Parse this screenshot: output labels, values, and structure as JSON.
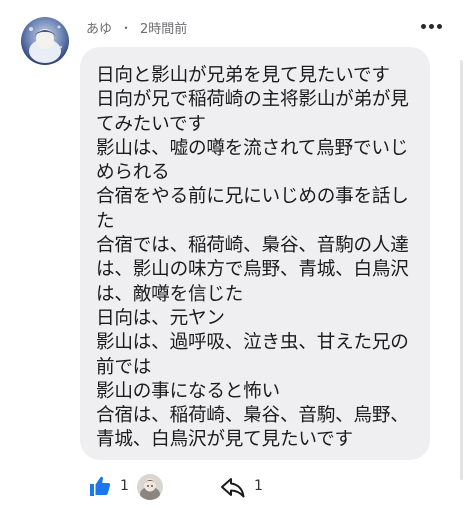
{
  "comment": {
    "author": "あゆ",
    "separator": "・",
    "time": "2時間前",
    "lines": [
      "日向と影山が兄弟を見て見たいです",
      "日向が兄で稲荷崎の主将影山が弟が見",
      "てみたいです",
      "影山は、嘘の噂を流されて烏野でいじ",
      "められる",
      "合宿をやる前に兄にいじめの事を話し",
      "た",
      "合宿では、稲荷崎、梟谷、音駒の人達",
      "は、影山の味方で烏野、青城、白鳥沢",
      "は、敵噂を信じた",
      "日向は、元ヤン",
      "影山は、過呼吸、泣き虫、甘えた兄の",
      "前では",
      "影山の事になると怖い",
      "合宿は、稲荷崎、梟谷、音駒、烏野、",
      "青城、白鳥沢が見て見たいです"
    ]
  },
  "actions": {
    "like_count": "1",
    "share_count": "1"
  },
  "icons": {
    "like": "thumbs-up-icon",
    "share": "share-arrow-icon",
    "more": "more-options-icon"
  },
  "colors": {
    "like_blue": "#1877f2",
    "bubble_bg": "#efeff1",
    "meta_gray": "#6e6e73"
  }
}
